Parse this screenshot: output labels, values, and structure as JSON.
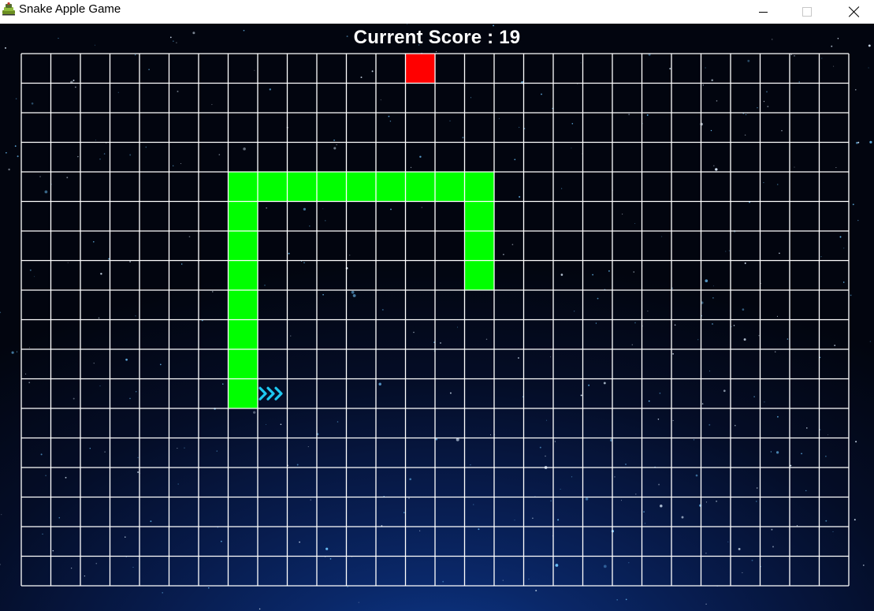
{
  "window": {
    "title": "Snake Apple Game",
    "icon": "snake-game-icon",
    "controls": [
      "minimize-icon",
      "maximize-icon",
      "close-icon"
    ]
  },
  "score": {
    "text": "Current Score : 19",
    "label": "Current Score",
    "value": 19
  },
  "board": {
    "columns": 28,
    "rows": 18,
    "grid_color": "#ffffff",
    "snake_color": "#00ff00",
    "apple_color": "#ff0000",
    "direction_indicator_color": "#1ec8f0",
    "direction": "right"
  },
  "snake": {
    "head": {
      "col": 7,
      "row": 11
    },
    "segments": [
      {
        "col": 7,
        "row": 11
      },
      {
        "col": 7,
        "row": 10
      },
      {
        "col": 7,
        "row": 9
      },
      {
        "col": 7,
        "row": 8
      },
      {
        "col": 7,
        "row": 7
      },
      {
        "col": 7,
        "row": 6
      },
      {
        "col": 7,
        "row": 5
      },
      {
        "col": 7,
        "row": 4
      },
      {
        "col": 8,
        "row": 4
      },
      {
        "col": 9,
        "row": 4
      },
      {
        "col": 10,
        "row": 4
      },
      {
        "col": 11,
        "row": 4
      },
      {
        "col": 12,
        "row": 4
      },
      {
        "col": 13,
        "row": 4
      },
      {
        "col": 14,
        "row": 4
      },
      {
        "col": 15,
        "row": 4
      },
      {
        "col": 15,
        "row": 5
      },
      {
        "col": 15,
        "row": 6
      },
      {
        "col": 15,
        "row": 7
      }
    ]
  },
  "apple": {
    "col": 13,
    "row": 0
  },
  "background": {
    "colors": [
      "#02050f",
      "#071a49",
      "#0d3a8f"
    ],
    "style": "starfield"
  }
}
